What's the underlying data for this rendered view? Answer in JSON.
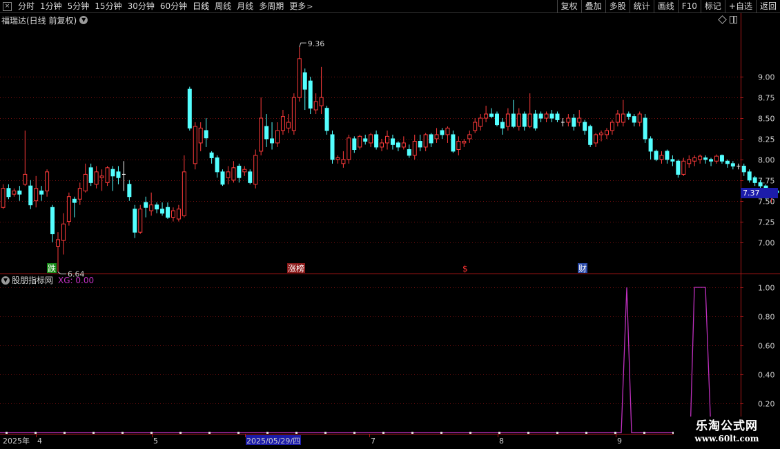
{
  "toolbar": {
    "periods": [
      "分时",
      "1分钟",
      "5分钟",
      "15分钟",
      "30分钟",
      "60分钟",
      "日线",
      "周线",
      "月线",
      "多周期",
      "更多"
    ],
    "active_period": "日线",
    "actions": [
      "复权",
      "叠加",
      "多股",
      "统计",
      "画线",
      "F10",
      "标记",
      "+自选",
      "返回"
    ]
  },
  "main_pane": {
    "title": "福瑞达(日线 前复权)",
    "price_axis_labels": [
      "9.00",
      "8.75",
      "8.50",
      "8.25",
      "8.00",
      "7.75",
      "7.50",
      "7.25",
      "7.00"
    ],
    "current_price": "7.37",
    "high_label": "9.36",
    "low_label": "6.64",
    "event_markers": [
      {
        "text": "跌",
        "color": "#1a8c1a"
      },
      {
        "text": "涨榜",
        "color": "#8c1a1a"
      },
      {
        "text": "$",
        "color": "#ff3333"
      },
      {
        "text": "财",
        "color": "#2a4aa8"
      }
    ]
  },
  "indicator_pane": {
    "title": "股朋指标网",
    "xg_label": "XG: 0.00",
    "axis_labels": [
      "1.00",
      "0.80",
      "0.60",
      "0.40",
      "0.20"
    ]
  },
  "date_axis": {
    "labels": [
      "2025年",
      "4",
      "5",
      "2025/05/29/四",
      "7",
      "8",
      "9"
    ]
  },
  "watermark": {
    "title": "乐淘公式网",
    "url": "www.60lt.com"
  },
  "colors": {
    "up": "#ff3b3b",
    "down": "#54ffff",
    "flat": "#ffffff",
    "grid": "#7a1010",
    "axis": "#b01818",
    "indicator_line": "#c030c0"
  },
  "chart_data": {
    "type": "candlestick",
    "title": "福瑞达(日线 前复权)",
    "ylim": [
      6.62,
      9.62
    ],
    "candles": [
      [
        7.42,
        7.65,
        7.4,
        7.7
      ],
      [
        7.65,
        7.55,
        7.52,
        7.7
      ],
      [
        7.58,
        7.62,
        7.55,
        7.65
      ],
      [
        7.62,
        7.58,
        7.5,
        7.68
      ],
      [
        7.7,
        7.82,
        7.68,
        8.35
      ],
      [
        7.68,
        7.45,
        7.4,
        7.75
      ],
      [
        7.5,
        7.65,
        7.42,
        7.8
      ],
      [
        7.62,
        7.58,
        7.5,
        7.68
      ],
      [
        7.62,
        7.85,
        7.55,
        7.88
      ],
      [
        7.42,
        7.1,
        7.0,
        7.45
      ],
      [
        6.95,
        7.03,
        6.64,
        7.12
      ],
      [
        7.02,
        7.22,
        6.85,
        7.35
      ],
      [
        7.25,
        7.55,
        7.2,
        7.6
      ],
      [
        7.52,
        7.48,
        7.3,
        7.55
      ],
      [
        7.52,
        7.65,
        7.45,
        7.72
      ],
      [
        7.62,
        7.82,
        7.6,
        7.95
      ],
      [
        7.9,
        7.72,
        7.68,
        7.95
      ],
      [
        7.7,
        7.85,
        7.65,
        7.92
      ],
      [
        7.78,
        7.8,
        7.62,
        7.88
      ],
      [
        7.72,
        7.9,
        7.68,
        7.92
      ],
      [
        7.88,
        7.8,
        7.62,
        7.92
      ],
      [
        7.85,
        7.78,
        7.7,
        7.92
      ],
      [
        7.82,
        7.82,
        7.62,
        7.98
      ],
      [
        7.7,
        7.55,
        7.5,
        7.75
      ],
      [
        7.4,
        7.12,
        7.05,
        7.45
      ],
      [
        7.12,
        7.4,
        7.1,
        7.45
      ],
      [
        7.48,
        7.42,
        7.3,
        7.55
      ],
      [
        7.38,
        7.45,
        7.32,
        7.6
      ],
      [
        7.45,
        7.4,
        7.35,
        7.48
      ],
      [
        7.4,
        7.35,
        7.32,
        7.48
      ],
      [
        7.42,
        7.3,
        7.28,
        7.48
      ],
      [
        7.3,
        7.38,
        7.25,
        7.42
      ],
      [
        7.28,
        7.4,
        7.25,
        7.45
      ],
      [
        7.32,
        7.85,
        7.3,
        8.05
      ],
      [
        8.85,
        8.38,
        8.35,
        8.88
      ],
      [
        7.95,
        8.4,
        7.88,
        8.45
      ],
      [
        8.2,
        8.38,
        8.1,
        8.45
      ],
      [
        8.35,
        8.26,
        8.15,
        8.5
      ],
      [
        8.08,
        8.02,
        7.95,
        8.1
      ],
      [
        8.02,
        7.85,
        7.78,
        8.05
      ],
      [
        7.85,
        7.7,
        7.68,
        7.88
      ],
      [
        7.78,
        7.85,
        7.7,
        7.92
      ],
      [
        7.75,
        7.9,
        7.72,
        7.98
      ],
      [
        7.92,
        7.78,
        7.72,
        7.95
      ],
      [
        7.85,
        7.88,
        7.8,
        7.92
      ],
      [
        7.85,
        7.72,
        7.7,
        7.88
      ],
      [
        7.7,
        8.05,
        7.65,
        8.12
      ],
      [
        8.1,
        8.5,
        8.05,
        8.75
      ],
      [
        8.4,
        8.25,
        8.15,
        8.55
      ],
      [
        8.25,
        8.2,
        8.12,
        8.45
      ],
      [
        8.2,
        8.35,
        8.15,
        8.45
      ],
      [
        8.35,
        8.52,
        8.3,
        8.6
      ],
      [
        8.38,
        8.45,
        8.32,
        8.55
      ],
      [
        8.35,
        8.75,
        8.3,
        8.8
      ],
      [
        8.75,
        9.22,
        8.7,
        9.36
      ],
      [
        9.05,
        8.85,
        8.6,
        9.1
      ],
      [
        8.95,
        8.62,
        8.55,
        9.0
      ],
      [
        8.6,
        8.7,
        8.55,
        8.8
      ],
      [
        8.65,
        8.75,
        8.55,
        9.12
      ],
      [
        8.62,
        8.35,
        8.3,
        8.65
      ],
      [
        8.3,
        8.0,
        7.95,
        8.35
      ],
      [
        8.0,
        8.02,
        7.95,
        8.05
      ],
      [
        7.95,
        8.0,
        7.9,
        8.1
      ],
      [
        8.0,
        8.26,
        7.95,
        8.3
      ],
      [
        8.25,
        8.12,
        8.08,
        8.28
      ],
      [
        8.15,
        8.28,
        8.12,
        8.3
      ],
      [
        8.25,
        8.22,
        8.18,
        8.3
      ],
      [
        8.2,
        8.3,
        8.15,
        8.32
      ],
      [
        8.3,
        8.15,
        8.12,
        8.35
      ],
      [
        8.15,
        8.2,
        8.1,
        8.25
      ],
      [
        8.2,
        8.28,
        8.12,
        8.35
      ],
      [
        8.25,
        8.18,
        8.12,
        8.3
      ],
      [
        8.2,
        8.15,
        8.1,
        8.22
      ],
      [
        8.15,
        8.2,
        8.12,
        8.28
      ],
      [
        8.12,
        8.05,
        8.02,
        8.18
      ],
      [
        8.05,
        8.22,
        8.0,
        8.3
      ],
      [
        8.22,
        8.15,
        8.1,
        8.3
      ],
      [
        8.15,
        8.3,
        8.1,
        8.32
      ],
      [
        8.3,
        8.2,
        8.15,
        8.32
      ],
      [
        8.25,
        8.3,
        8.2,
        8.38
      ],
      [
        8.35,
        8.3,
        8.25,
        8.38
      ],
      [
        8.3,
        8.38,
        8.2,
        8.4
      ],
      [
        8.3,
        8.1,
        8.08,
        8.35
      ],
      [
        8.12,
        8.22,
        8.05,
        8.28
      ],
      [
        8.2,
        8.22,
        8.15,
        8.25
      ],
      [
        8.25,
        8.3,
        8.2,
        8.35
      ],
      [
        8.35,
        8.45,
        8.32,
        8.5
      ],
      [
        8.4,
        8.5,
        8.35,
        8.55
      ],
      [
        8.5,
        8.55,
        8.45,
        8.65
      ],
      [
        8.55,
        8.52,
        8.5,
        8.62
      ],
      [
        8.55,
        8.42,
        8.4,
        8.58
      ],
      [
        8.45,
        8.38,
        8.3,
        8.5
      ],
      [
        8.4,
        8.55,
        8.35,
        8.62
      ],
      [
        8.55,
        8.4,
        8.38,
        8.72
      ],
      [
        8.4,
        8.55,
        8.35,
        8.62
      ],
      [
        8.55,
        8.4,
        8.35,
        8.58
      ],
      [
        8.4,
        8.55,
        8.38,
        8.8
      ],
      [
        8.55,
        8.38,
        8.35,
        8.6
      ],
      [
        8.55,
        8.5,
        8.45,
        8.58
      ],
      [
        8.5,
        8.55,
        8.45,
        8.58
      ],
      [
        8.55,
        8.5,
        8.45,
        8.6
      ],
      [
        8.55,
        8.48,
        8.45,
        8.58
      ],
      [
        8.45,
        8.45,
        8.4,
        8.5
      ],
      [
        8.45,
        8.5,
        8.4,
        8.55
      ],
      [
        8.5,
        8.4,
        8.35,
        8.55
      ],
      [
        8.45,
        8.5,
        8.4,
        8.6
      ],
      [
        8.45,
        8.35,
        8.3,
        8.48
      ],
      [
        8.4,
        8.18,
        8.15,
        8.42
      ],
      [
        8.2,
        8.3,
        8.15,
        8.32
      ],
      [
        8.3,
        8.32,
        8.22,
        8.35
      ],
      [
        8.3,
        8.35,
        8.25,
        8.38
      ],
      [
        8.35,
        8.45,
        8.3,
        8.48
      ],
      [
        8.45,
        8.55,
        8.4,
        8.6
      ],
      [
        8.45,
        8.55,
        8.4,
        8.72
      ],
      [
        8.55,
        8.52,
        8.48,
        8.58
      ],
      [
        8.52,
        8.45,
        8.4,
        8.55
      ],
      [
        8.45,
        8.55,
        8.4,
        8.58
      ],
      [
        8.5,
        8.25,
        8.2,
        8.55
      ],
      [
        8.25,
        8.1,
        8.0,
        8.28
      ],
      [
        8.1,
        8.0,
        7.98,
        8.12
      ],
      [
        8.0,
        8.05,
        7.95,
        8.1
      ],
      [
        8.1,
        8.0,
        7.95,
        8.12
      ],
      [
        8.0,
        7.98,
        7.92,
        8.05
      ],
      [
        7.98,
        7.82,
        7.78,
        8.0
      ],
      [
        7.82,
        7.98,
        7.8,
        8.02
      ],
      [
        7.95,
        8.0,
        7.9,
        8.05
      ],
      [
        7.98,
        8.02,
        7.92,
        8.05
      ],
      [
        8.0,
        8.04,
        7.95,
        8.06
      ],
      [
        8.02,
        8.0,
        7.95,
        8.05
      ],
      [
        8.0,
        7.98,
        7.92,
        8.02
      ],
      [
        7.98,
        8.04,
        7.95,
        8.06
      ],
      [
        8.05,
        7.98,
        7.95,
        8.06
      ],
      [
        7.98,
        7.95,
        7.9,
        8.0
      ],
      [
        7.95,
        7.92,
        7.88,
        7.98
      ],
      [
        7.92,
        7.92,
        7.88,
        7.95
      ],
      [
        7.92,
        7.85,
        7.8,
        7.95
      ],
      [
        7.85,
        7.75,
        7.72,
        7.88
      ],
      [
        7.78,
        7.72,
        7.68,
        7.8
      ],
      [
        7.72,
        7.68,
        7.6,
        7.75
      ],
      [
        7.68,
        7.6,
        7.52,
        7.7
      ],
      [
        7.6,
        7.62,
        7.48,
        7.65
      ],
      [
        7.62,
        7.6,
        7.55,
        7.65
      ],
      [
        7.6,
        7.64,
        7.55,
        7.65
      ]
    ],
    "indicator": {
      "name": "XG",
      "ylim": [
        0,
        1.0
      ],
      "values_visible": "0 everywhere except two spikes to 1.00 (one single-day near 9月 and one multi-day plateau after)"
    }
  }
}
